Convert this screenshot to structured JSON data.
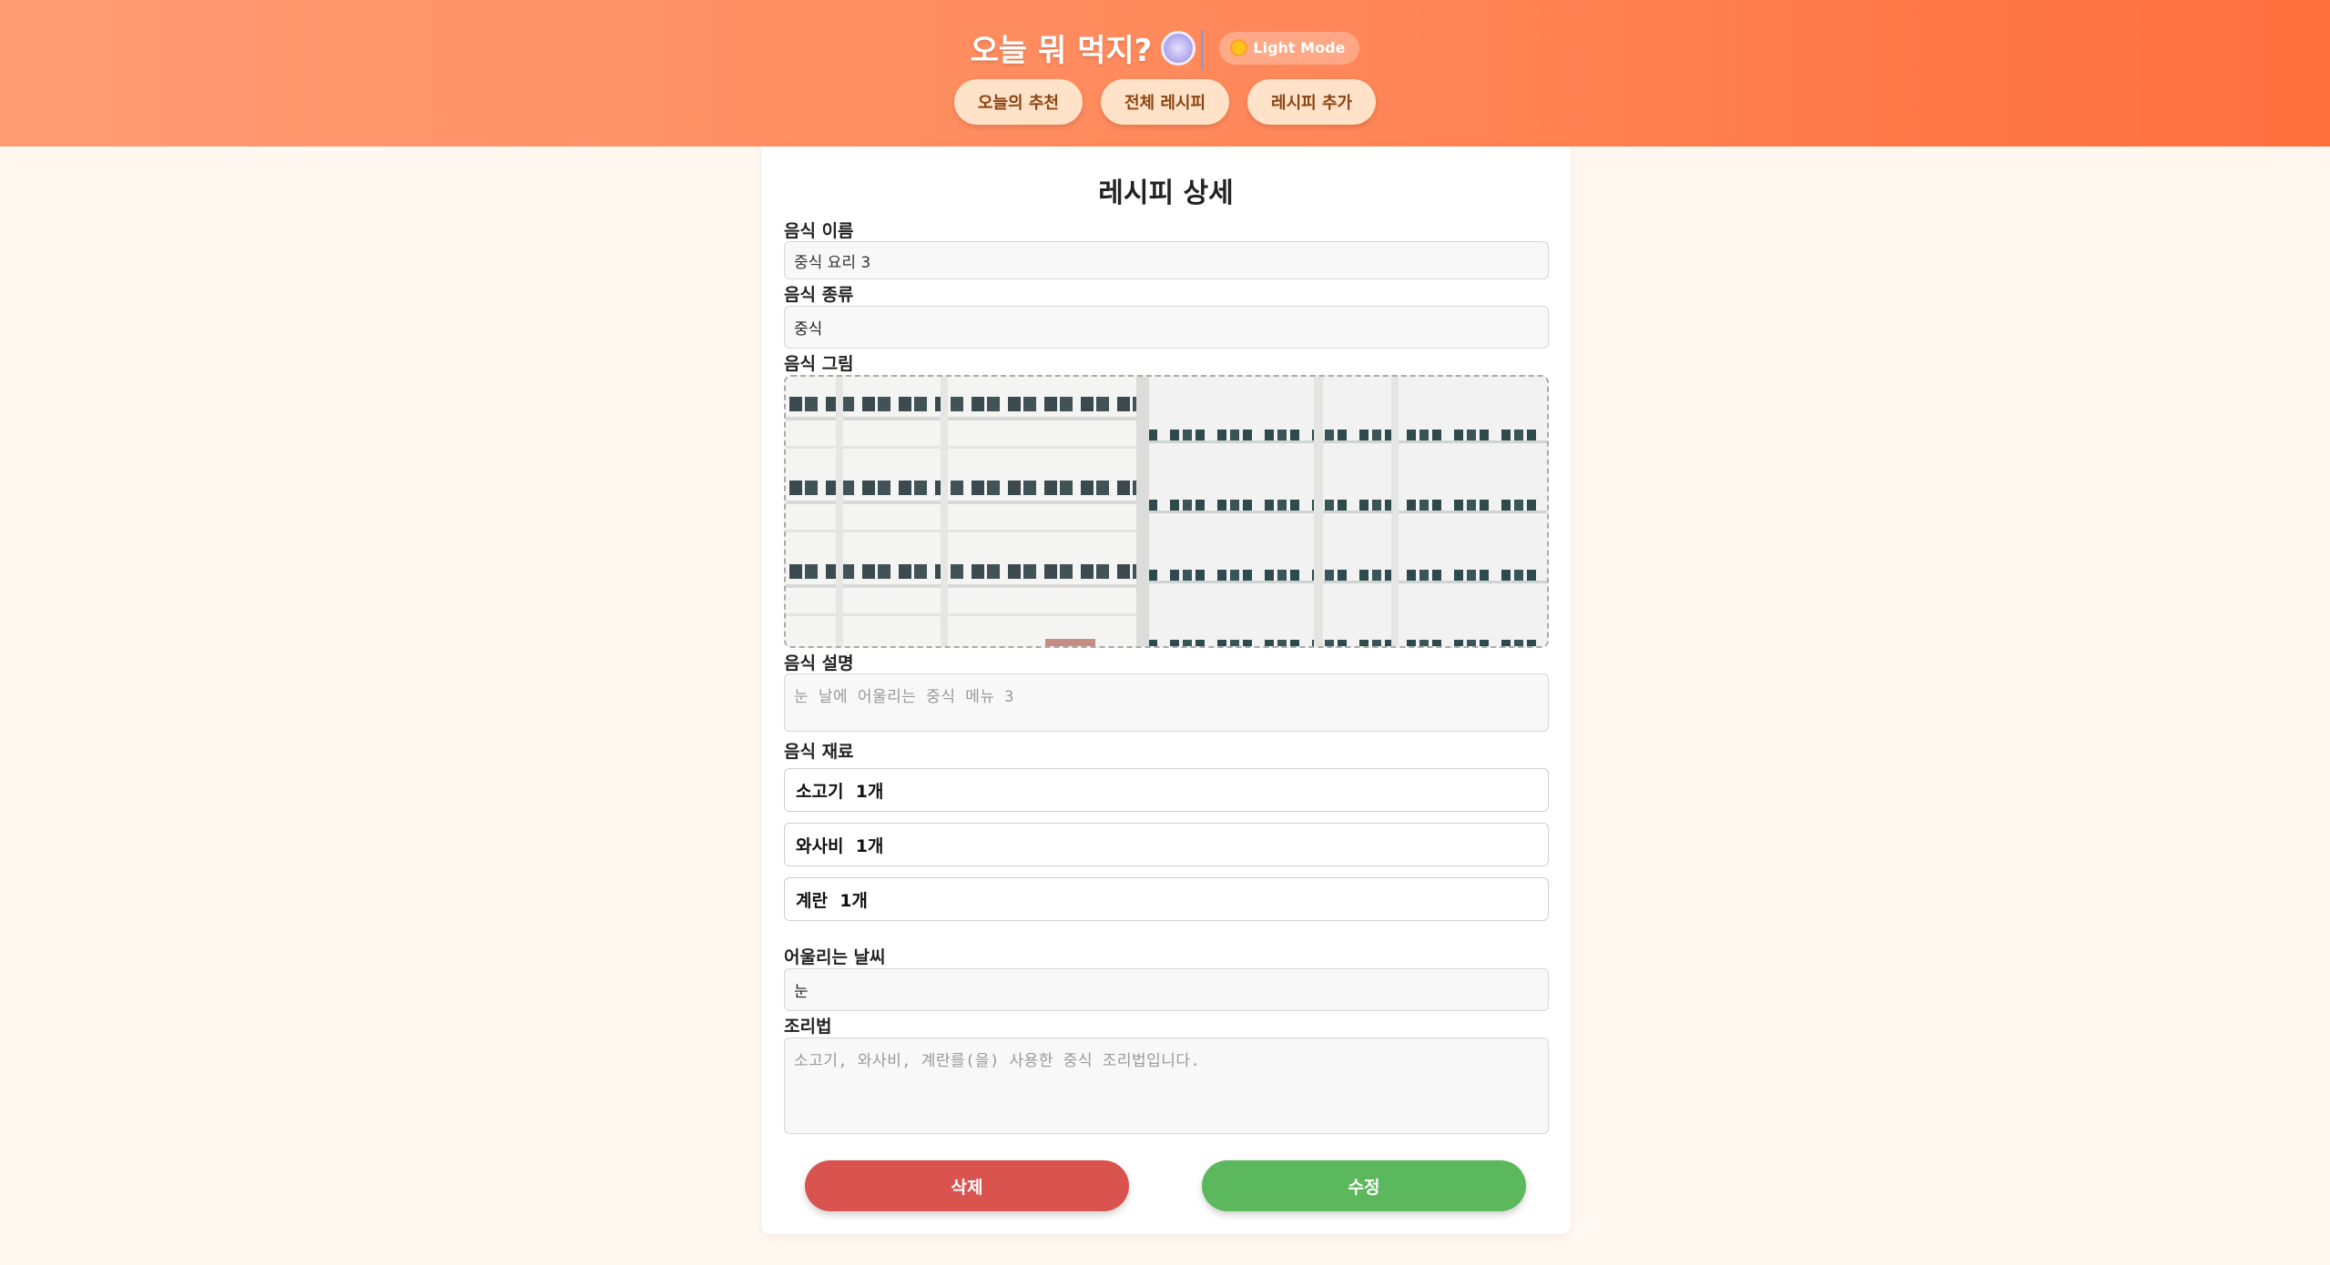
{
  "header": {
    "title": "오늘 뭐 먹지?",
    "mode_toggle_label": "Light Mode",
    "nav": [
      {
        "label": "오늘의 추천"
      },
      {
        "label": "전체 레시피"
      },
      {
        "label": "레시피 추가"
      }
    ]
  },
  "detail": {
    "title": "레시피 상세",
    "name_label": "음식 이름",
    "name_value": "중식 요리 3",
    "type_label": "음식 종류",
    "type_value": "중식",
    "image_label": "음식 그림",
    "description_label": "음식 설명",
    "description_placeholder": "눈 날에 어울리는 중식 메뉴 3",
    "ingredients_label": "음식 재료",
    "ingredients": [
      {
        "name": "소고기",
        "amount": "1개"
      },
      {
        "name": "와사비",
        "amount": "1개"
      },
      {
        "name": "계란",
        "amount": "1개"
      }
    ],
    "weather_label": "어울리는 날씨",
    "weather_value": "눈",
    "recipe_label": "조리법",
    "recipe_placeholder": "소고기, 와사비, 계란를(을) 사용한 중식 조리법입니다.",
    "delete_label": "삭제",
    "edit_label": "수정"
  },
  "colors": {
    "header_gradient_start": "#ff9b73",
    "header_gradient_end": "#ff6f3e",
    "delete": "#d9534f",
    "edit": "#5cb85c"
  }
}
